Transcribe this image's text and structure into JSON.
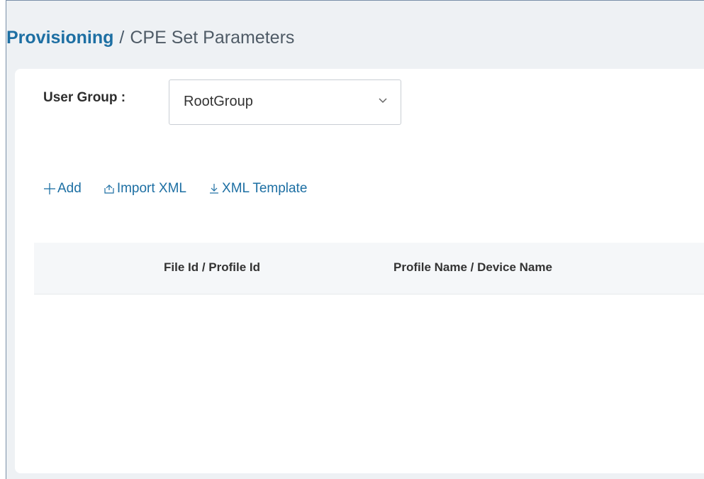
{
  "breadcrumb": {
    "root": "Provisioning",
    "separator": "/",
    "current": "CPE Set Parameters"
  },
  "user_group": {
    "label": "User Group :",
    "selected": "RootGroup"
  },
  "toolbar": {
    "add_label": "Add",
    "import_label": "Import XML",
    "template_label": "XML Template"
  },
  "table": {
    "columns": [
      "File Id / Profile Id",
      "Profile Name / Device Name"
    ]
  },
  "icons": {
    "add": "plus-icon",
    "import": "upload-icon",
    "template": "download-icon",
    "select": "chevron-down-icon"
  },
  "colors": {
    "accent": "#1d6fa3",
    "background": "#eef1f4",
    "card": "#ffffff"
  }
}
